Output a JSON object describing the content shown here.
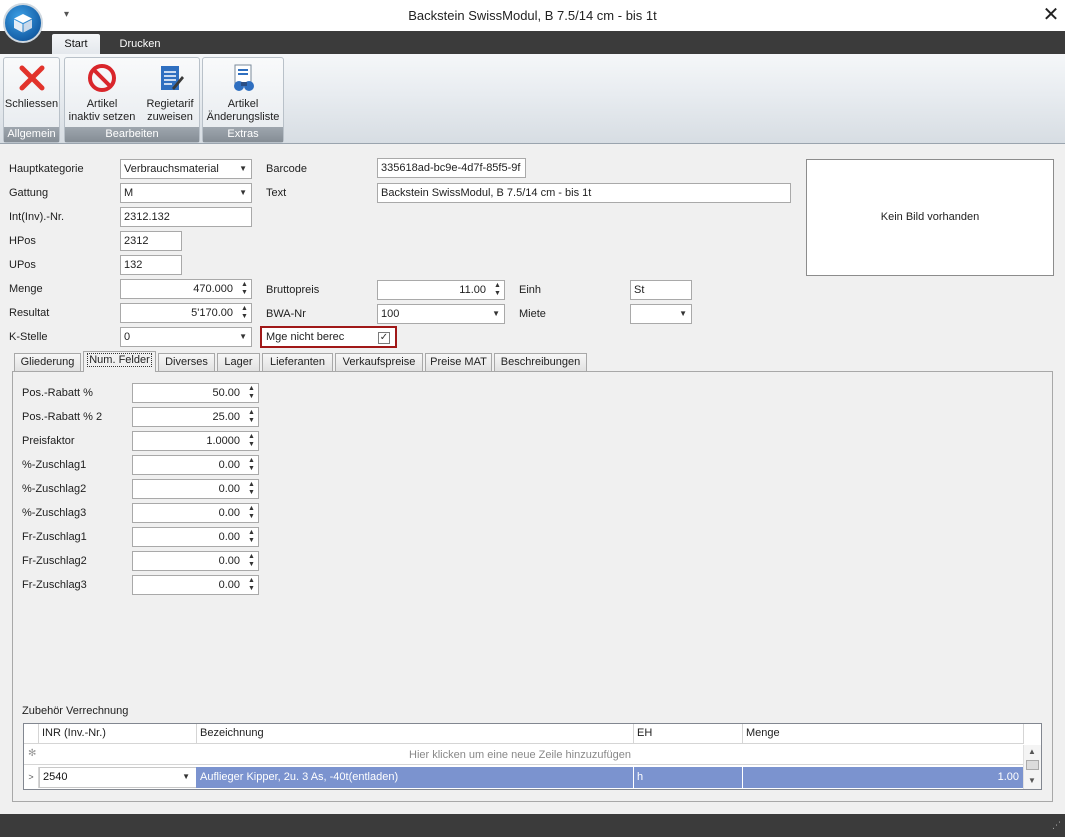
{
  "window": {
    "title": "Backstein SwissModul, B 7.5/14 cm - bis 1t",
    "close_glyph": "✕",
    "qa_glyph": "▾"
  },
  "ribbon_tabs": [
    {
      "label": "Start"
    },
    {
      "label": "Drucken"
    }
  ],
  "ribbon": {
    "groups": [
      {
        "caption": "Allgemein"
      },
      {
        "caption": "Bearbeiten"
      },
      {
        "caption": "Extras"
      }
    ],
    "buttons": {
      "schliessen": {
        "line1": "Schliessen",
        "line2": ""
      },
      "inaktiv": {
        "line1": "Artikel",
        "line2": "inaktiv setzen"
      },
      "regietarif": {
        "line1": "Regietarif",
        "line2": "zuweisen"
      },
      "aenderung": {
        "line1": "Artikel",
        "line2": "Änderungsliste"
      }
    },
    "colors": {
      "close_red": "#e2332b",
      "block_red": "#d9262b",
      "doc_blue": "#2f6fc0"
    }
  },
  "form": {
    "hauptkategorie": {
      "label": "Hauptkategorie",
      "value": "Verbrauchsmaterial"
    },
    "gattung": {
      "label": "Gattung",
      "value": "M"
    },
    "int_nr": {
      "label": "Int(Inv).-Nr.",
      "value": "2312.132"
    },
    "hpos": {
      "label": "HPos",
      "value": "2312"
    },
    "upos": {
      "label": "UPos",
      "value": "132"
    },
    "menge": {
      "label": "Menge",
      "value": "470.000"
    },
    "resultat": {
      "label": "Resultat",
      "value": "5'170.00"
    },
    "kstelle": {
      "label": "K-Stelle",
      "value": "0"
    },
    "barcode": {
      "label": "Barcode",
      "value": "335618ad-bc9e-4d7f-85f5-9f"
    },
    "text": {
      "label": "Text",
      "value": "Backstein SwissModul, B 7.5/14 cm - bis 1t"
    },
    "bruttopreis": {
      "label": "Bruttopreis",
      "value": "11.00"
    },
    "bwa_nr": {
      "label": "BWA-Nr",
      "value": "100"
    },
    "mge_nicht_berec": {
      "label": "Mge nicht berec",
      "checked": true,
      "check_glyph": "✓"
    },
    "einh": {
      "label": "Einh",
      "value": "St"
    },
    "miete": {
      "label": "Miete",
      "value": ""
    },
    "image_placeholder": "Kein Bild vorhanden"
  },
  "tabs": [
    {
      "label": "Gliederung"
    },
    {
      "label": "Num. Felder"
    },
    {
      "label": "Diverses"
    },
    {
      "label": "Lager"
    },
    {
      "label": "Lieferanten"
    },
    {
      "label": "Verkaufspreise"
    },
    {
      "label": "Preise MAT"
    },
    {
      "label": "Beschreibungen"
    }
  ],
  "num_fields": [
    {
      "label": "Pos.-Rabatt %",
      "value": "50.00"
    },
    {
      "label": "Pos.-Rabatt % 2",
      "value": "25.00"
    },
    {
      "label": "Preisfaktor",
      "value": "1.0000"
    },
    {
      "label": "%-Zuschlag1",
      "value": "0.00"
    },
    {
      "label": "%-Zuschlag2",
      "value": "0.00"
    },
    {
      "label": "%-Zuschlag3",
      "value": "0.00"
    },
    {
      "label": "Fr-Zuschlag1",
      "value": "0.00"
    },
    {
      "label": "Fr-Zuschlag2",
      "value": "0.00"
    },
    {
      "label": "Fr-Zuschlag3",
      "value": "0.00"
    }
  ],
  "zubehoer": {
    "title": "Zubehör Verrechnung",
    "columns": [
      "INR (Inv.-Nr.)",
      "Bezeichnung",
      "EH",
      "Menge"
    ],
    "new_row_hint": "Hier klicken um eine neue Zeile hinzuzufügen",
    "rows": [
      {
        "inr": "2540",
        "bezeichnung": "Auflieger Kipper, 2u. 3 As, -40t(entladen)",
        "eh": "h",
        "menge": "1.00"
      }
    ],
    "selection_color": "#7b93cf"
  }
}
